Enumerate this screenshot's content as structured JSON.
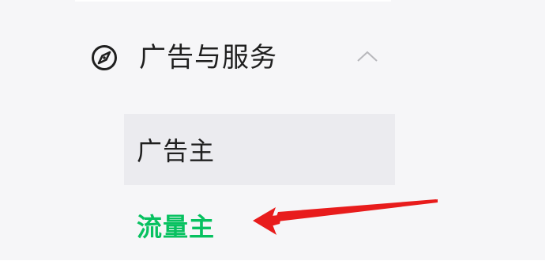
{
  "sidebar": {
    "group": {
      "title": "广告与服务",
      "icon": "compass-icon",
      "expand_icon": "chevron-up-icon",
      "expanded": true
    },
    "items": [
      {
        "label": "广告主",
        "selected": true
      },
      {
        "label": "流量主",
        "selected": false,
        "color": "#07c160"
      }
    ]
  },
  "annotation": {
    "type": "arrow",
    "color": "#e81c1c",
    "points_to": "流量主"
  }
}
